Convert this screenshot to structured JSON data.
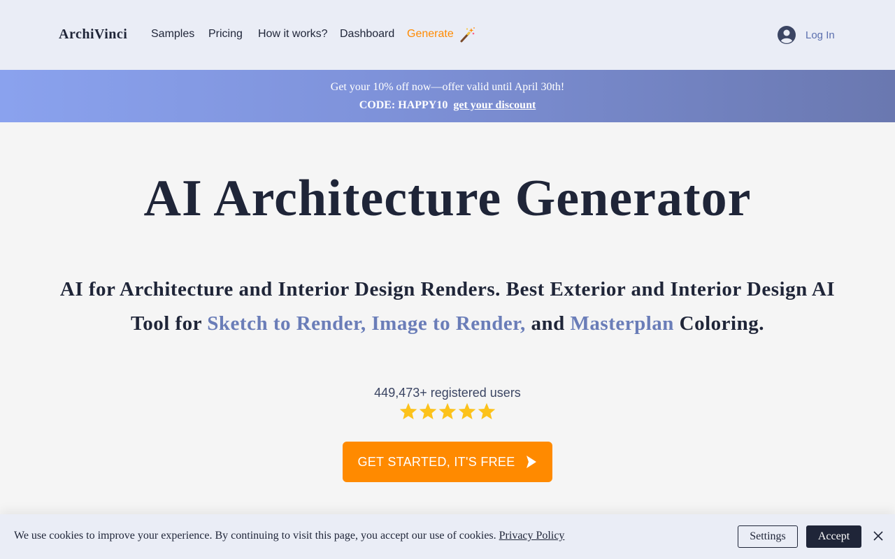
{
  "header": {
    "logo": "ArchiVinci",
    "nav": {
      "samples": "Samples",
      "pricing": "Pricing",
      "how_it_works": "How it works?",
      "dashboard": "Dashboard",
      "generate": "Generate"
    },
    "generate_icon": "magic-wand-icon",
    "login_icon": "user-circle-icon",
    "login_label": "Log In"
  },
  "promo": {
    "line1": "Get your 10% off now—offer valid until April 30th!",
    "code": "CODE: HAPPY10",
    "link": "get your discount"
  },
  "hero": {
    "title": "AI Architecture Generator",
    "subtitle_part1": "AI for Architecture and Interior Design Renders. Best Exterior and Interior Design AI Tool for ",
    "subtitle_highlight1": "Sketch to Render, Image to Render,",
    "subtitle_part2": " and ",
    "subtitle_highlight2": "Masterplan",
    "subtitle_part3": " Coloring.",
    "users_count": "449,473+ registered users",
    "rating_stars": 5,
    "cta_label": "GET STARTED, IT'S FREE",
    "cta_icon": "play-icon"
  },
  "cookie": {
    "text": "We use cookies to improve your experience. By continuing to visit this page, you accept our use of cookies. ",
    "policy_link": "Privacy Policy",
    "settings_label": "Settings",
    "accept_label": "Accept",
    "close_icon": "close-icon"
  },
  "colors": {
    "header_bg": "#eaedf6",
    "accent_orange": "#ff8a00",
    "dark_navy": "#1f2538",
    "highlight_blue": "#6a7db8",
    "star_gold": "#fcc21b"
  }
}
